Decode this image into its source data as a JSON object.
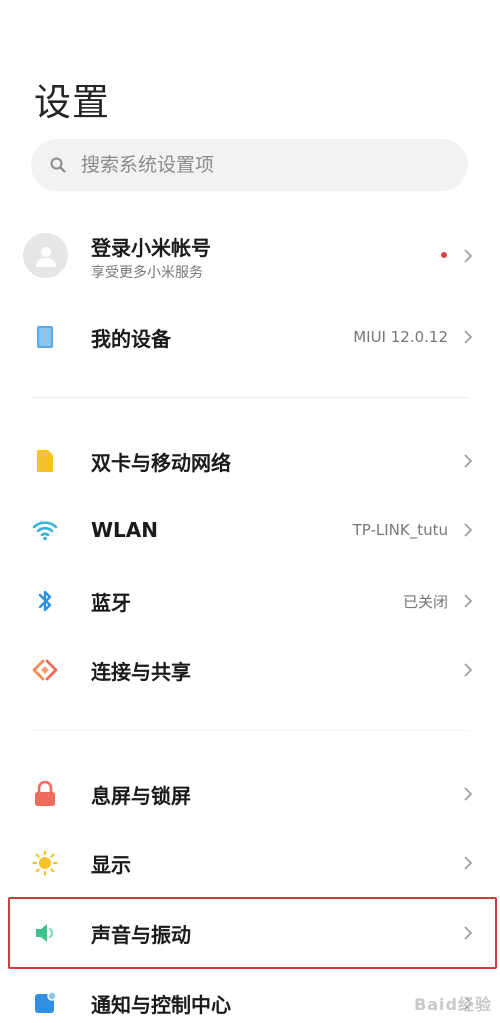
{
  "page": {
    "title": "设置"
  },
  "search": {
    "placeholder": "搜索系统设置项"
  },
  "account": {
    "title": "登录小米帐号",
    "subtitle": "享受更多小米服务"
  },
  "rows": [
    {
      "label": "我的设备",
      "value": "MIUI 12.0.12",
      "icon": "tablet-icon",
      "color": "#5aa9e6"
    },
    {
      "label": "双卡与移动网络",
      "value": "",
      "icon": "sim-card-icon",
      "color": "#f5c22b"
    },
    {
      "label": "WLAN",
      "value": "TP-LINK_tutu",
      "icon": "wifi-icon",
      "color": "#36b3d6"
    },
    {
      "label": "蓝牙",
      "value": "已关闭",
      "icon": "bluetooth-icon",
      "color": "#2f8fe0"
    },
    {
      "label": "连接与共享",
      "value": "",
      "icon": "connection-share-icon",
      "color": "#f08c5a"
    },
    {
      "label": "息屏与锁屏",
      "value": "",
      "icon": "lock-icon",
      "color": "#f06b5b"
    },
    {
      "label": "显示",
      "value": "",
      "icon": "brightness-icon",
      "color": "#f5c22b"
    },
    {
      "label": "声音与振动",
      "value": "",
      "icon": "speaker-icon",
      "color": "#3cc48a"
    },
    {
      "label": "通知与控制中心",
      "value": "",
      "icon": "notification-icon",
      "color": "#2f8fe0"
    }
  ],
  "watermark": "Baid经验"
}
